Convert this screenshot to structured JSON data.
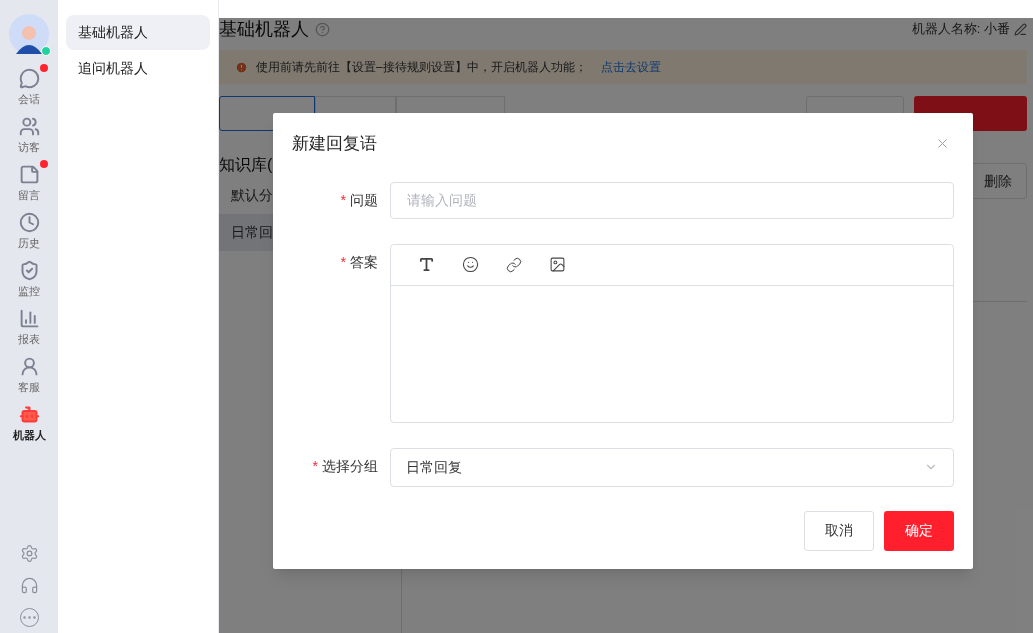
{
  "nav_rail": {
    "avatar": {
      "online": true
    },
    "items": [
      {
        "label": "会话",
        "selected": false,
        "badge": true
      },
      {
        "label": "访客",
        "selected": false,
        "badge": false
      },
      {
        "label": "留言",
        "selected": false,
        "badge": true
      },
      {
        "label": "历史",
        "selected": false,
        "badge": false
      },
      {
        "label": "监控",
        "selected": false,
        "badge": false
      },
      {
        "label": "报表",
        "selected": false,
        "badge": false
      },
      {
        "label": "客服",
        "selected": false,
        "badge": false
      },
      {
        "label": "机器人",
        "selected": true,
        "badge": false
      }
    ]
  },
  "subnav": {
    "items": [
      {
        "label": "基础机器人",
        "selected": true
      },
      {
        "label": "追问机器人",
        "selected": false
      }
    ]
  },
  "page": {
    "title": "基础机器人",
    "robot_name": "机器人名称: 小番",
    "notice": {
      "text": "使用前请先前往【设置–接待规则设置】中，开启机器人功能；",
      "link": "点击去设置"
    },
    "tabs": [
      {
        "selected": true
      },
      {
        "selected": false
      },
      {
        "selected": false
      }
    ],
    "actions": [
      {
        "kind": "default"
      },
      {
        "kind": "primary"
      }
    ],
    "knowledge": {
      "title": "知识库(",
      "groups": [
        {
          "label": "默认分",
          "selected": false
        },
        {
          "label": "日常回",
          "selected": true
        }
      ]
    },
    "table_action": "删除"
  },
  "dialog": {
    "title": "新建回复语",
    "required_mark": "*",
    "fields": [
      {
        "kind": "input",
        "label": "问题",
        "required": true,
        "placeholder": "请输入问题"
      },
      {
        "kind": "editor",
        "label": "答案",
        "required": true
      },
      {
        "kind": "select",
        "label": "选择分组",
        "required": true,
        "value": "日常回复"
      }
    ],
    "buttons": [
      {
        "label": "取消",
        "kind": "default"
      },
      {
        "label": "确定",
        "kind": "primary"
      }
    ]
  }
}
